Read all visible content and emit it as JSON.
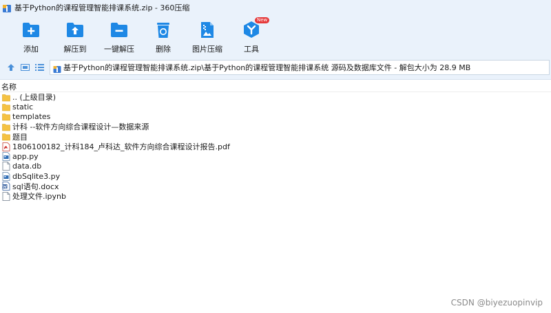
{
  "window": {
    "title": "基于Python的课程管理智能排课系统.zip - 360压缩"
  },
  "toolbar": {
    "items": [
      {
        "label": "添加",
        "icon": "add-folder-icon"
      },
      {
        "label": "解压到",
        "icon": "extract-to-icon"
      },
      {
        "label": "一键解压",
        "icon": "one-click-extract-icon"
      },
      {
        "label": "删除",
        "icon": "recycle-delete-icon"
      },
      {
        "label": "图片压缩",
        "icon": "image-compress-icon"
      },
      {
        "label": "工具",
        "icon": "tools-icon",
        "badge": "New"
      }
    ]
  },
  "address": {
    "path": "基于Python的课程管理智能排课系统.zip\\基于Python的课程管理智能排课系统 源码及数据库文件 - 解包大小为 28.9 MB"
  },
  "list": {
    "column_name": "名称",
    "rows": [
      {
        "name": ".. (上级目录)",
        "type": "folder"
      },
      {
        "name": "static",
        "type": "folder"
      },
      {
        "name": "templates",
        "type": "folder"
      },
      {
        "name": "计科 --软件方向综合课程设计—数据来源",
        "type": "folder"
      },
      {
        "name": "题目",
        "type": "folder"
      },
      {
        "name": "1806100182_计科184_卢科达_软件方向综合课程设计报告.pdf",
        "type": "pdf"
      },
      {
        "name": "app.py",
        "type": "py"
      },
      {
        "name": "data.db",
        "type": "file"
      },
      {
        "name": "dbSqlite3.py",
        "type": "py"
      },
      {
        "name": "sql语句.docx",
        "type": "docx"
      },
      {
        "name": "处理文件.ipynb",
        "type": "file"
      }
    ]
  },
  "watermark": "CSDN @biyezuopinvip",
  "colors": {
    "chrome": "#eaf2fb",
    "accent": "#1e88e5",
    "folder": "#f5c242"
  }
}
